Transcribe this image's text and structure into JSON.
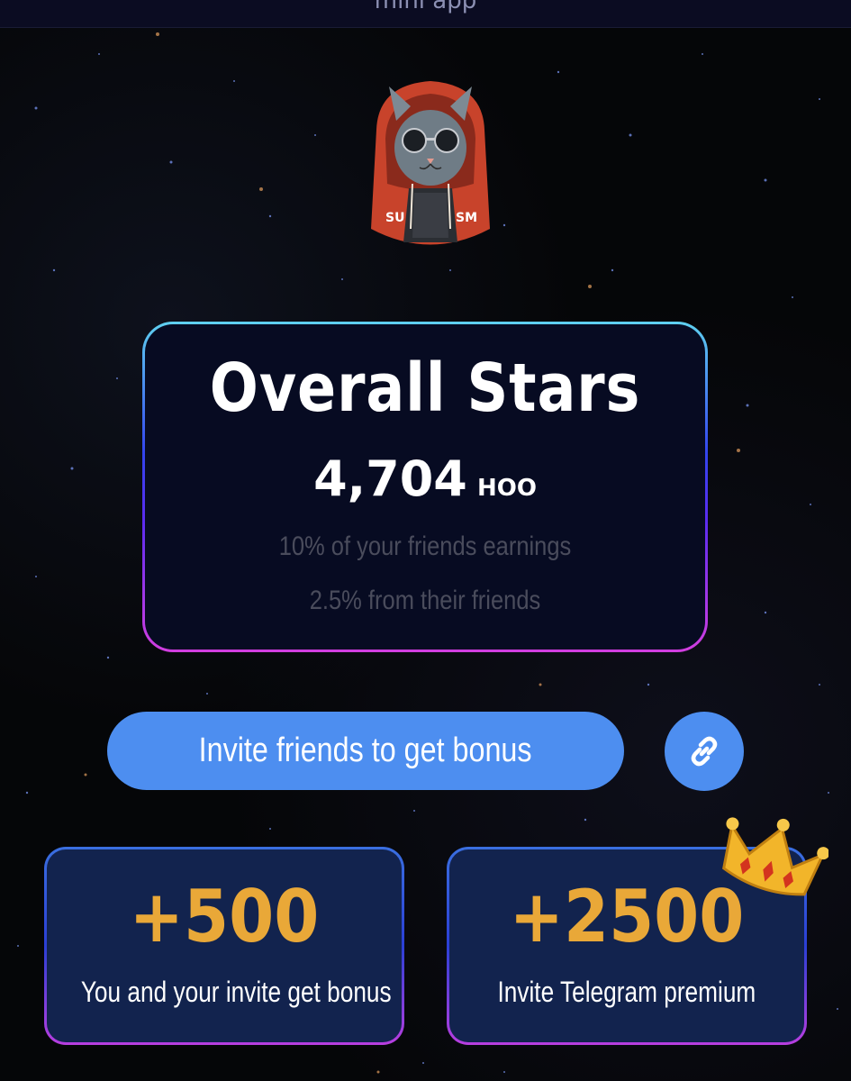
{
  "topbar": {
    "title": "mini app"
  },
  "stats": {
    "title": "Overall Stars",
    "value": "4,704",
    "unit": "HOO",
    "note1": "10% of your friends earnings",
    "note2": "2.5% from their friends"
  },
  "invite": {
    "label": "Invite friends to get bonus",
    "link_icon": "link-icon"
  },
  "bonuses": [
    {
      "value": "+500",
      "label": "You and your invite get bonus"
    },
    {
      "value": "+2500",
      "label": "Invite Telegram premium"
    }
  ],
  "avatar": {
    "text_left": "SU",
    "text_right": "SM"
  },
  "colors": {
    "button": "#4d8ef0",
    "bonus_value": "#e9a838",
    "card_bg": "#070b22",
    "bonus_bg": "#12234e"
  }
}
